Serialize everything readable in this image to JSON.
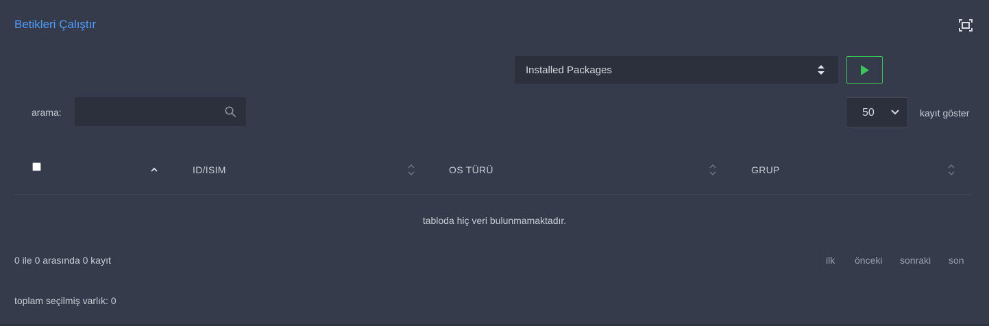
{
  "panel": {
    "title": "Betikleri Çalıştır"
  },
  "script_select": {
    "value": "Installed Packages"
  },
  "search": {
    "label": "arama:",
    "value": ""
  },
  "page_length": {
    "value": "50",
    "label": "kayıt göster"
  },
  "table": {
    "columns": [
      "ID/ISIM",
      "OS TÜRÜ",
      "GRUP"
    ],
    "empty_message": "tabloda hiç veri bulunmamaktadır."
  },
  "footer": {
    "info": "0 ile 0 arasında 0 kayıt",
    "pagination": {
      "first": "ilk",
      "previous": "önceki",
      "next": "sonraki",
      "last": "son"
    },
    "selected_total": "toplam seçilmiş varlık: 0"
  },
  "colors": {
    "background": "#353b4b",
    "field": "#2b303c",
    "title": "#4f9dff",
    "run_button": "#3cc45c"
  },
  "icons": {
    "expand": "fullscreen-icon",
    "run": "play-icon",
    "search": "search-icon",
    "dropdown": "chevron-down-icon",
    "sort": "sort-icon"
  }
}
